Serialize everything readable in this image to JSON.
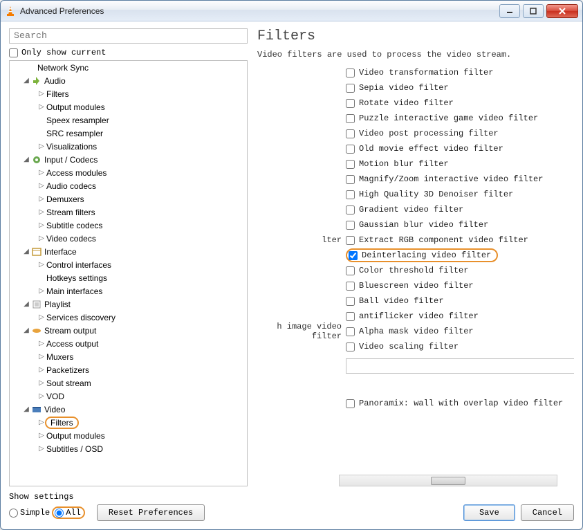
{
  "window": {
    "title": "Advanced Preferences"
  },
  "search": {
    "placeholder": "Search"
  },
  "only_current": {
    "label": "Only show current"
  },
  "tree": {
    "network_sync": "Network Sync",
    "audio": "Audio",
    "audio_filters": "Filters",
    "audio_output": "Output modules",
    "audio_speex": "Speex resampler",
    "audio_src": "SRC resampler",
    "audio_vis": "Visualizations",
    "input": "Input / Codecs",
    "input_access": "Access modules",
    "input_audio": "Audio codecs",
    "input_demux": "Demuxers",
    "input_stream": "Stream filters",
    "input_sub": "Subtitle codecs",
    "input_video": "Video codecs",
    "interface": "Interface",
    "if_control": "Control interfaces",
    "if_hotkeys": "Hotkeys settings",
    "if_main": "Main interfaces",
    "playlist": "Playlist",
    "pl_services": "Services discovery",
    "sout": "Stream output",
    "sout_access": "Access output",
    "sout_muxers": "Muxers",
    "sout_packet": "Packetizers",
    "sout_stream": "Sout stream",
    "sout_vod": "VOD",
    "video": "Video",
    "video_filters": "Filters",
    "video_output": "Output modules",
    "video_sub": "Subtitles / OSD"
  },
  "page": {
    "heading": "Filters",
    "description": "Video filters are used to process the video stream."
  },
  "filters": {
    "leftlabel_lter": "lter",
    "leftlabel_himage": "h image video filter",
    "items": [
      "Video transformation filter",
      "Sepia video filter",
      "Rotate video filter",
      "Puzzle interactive game video filter",
      "Video post processing filter",
      "Old movie effect video filter",
      "Motion blur filter",
      "Magnify/Zoom interactive video filter",
      "High Quality 3D Denoiser filter",
      "Gradient video filter",
      "Gaussian blur video filter",
      "Extract RGB component video filter",
      "Deinterlacing video filter",
      "Color threshold filter",
      "Bluescreen video filter",
      "Ball video filter",
      "antiflicker video filter",
      "Alpha mask video filter",
      "Video scaling filter"
    ],
    "panoramix": "Panoramix: wall with overlap video filter",
    "checked_index": 12
  },
  "bottom": {
    "show_label": "Show settings",
    "simple": "Simple",
    "all": "All",
    "reset": "Reset Preferences",
    "save": "Save",
    "cancel": "Cancel"
  }
}
